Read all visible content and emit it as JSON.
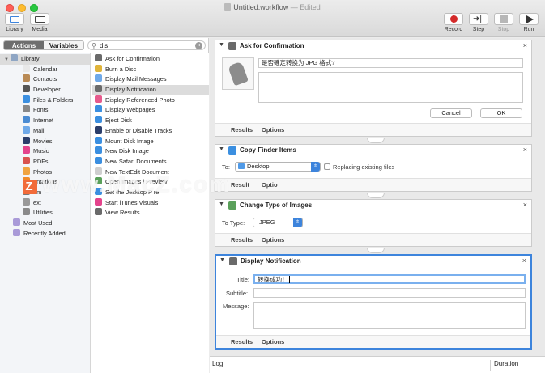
{
  "window": {
    "title": "Untitled.workflow",
    "subtitle": "— Edited"
  },
  "toolbar": {
    "library_label": "Library",
    "media_label": "Media",
    "record_label": "Record",
    "step_label": "Step",
    "stop_label": "Stop",
    "run_label": "Run"
  },
  "sidebar": {
    "tabs": {
      "actions": "Actions",
      "variables": "Variables"
    },
    "search": {
      "value": "dis"
    },
    "library": {
      "root": "Library",
      "items": [
        {
          "label": "Calendar",
          "icon": "calendar-icon",
          "color": "#e8e8e8"
        },
        {
          "label": "Contacts",
          "icon": "contacts-icon",
          "color": "#b98a55"
        },
        {
          "label": "Developer",
          "icon": "developer-icon",
          "color": "#555555"
        },
        {
          "label": "Files & Folders",
          "icon": "finder-icon",
          "color": "#3b8fe0"
        },
        {
          "label": "Fonts",
          "icon": "fonts-icon",
          "color": "#888888"
        },
        {
          "label": "Internet",
          "icon": "globe-icon",
          "color": "#4a8bd2"
        },
        {
          "label": "Mail",
          "icon": "mail-icon",
          "color": "#6fa9e8"
        },
        {
          "label": "Movies",
          "icon": "movies-icon",
          "color": "#2b3e6b"
        },
        {
          "label": "Music",
          "icon": "music-icon",
          "color": "#e4438c"
        },
        {
          "label": "PDFs",
          "icon": "pdf-icon",
          "color": "#d9534f"
        },
        {
          "label": "Photos",
          "icon": "photos-icon",
          "color": "#f0a440"
        },
        {
          "label": "entations",
          "icon": "presentation-icon",
          "color": "#f08a2a"
        },
        {
          "label": "em",
          "icon": "system-icon",
          "color": "#777777"
        },
        {
          "label": "ext",
          "icon": "text-icon",
          "color": "#999999"
        },
        {
          "label": "Utilities",
          "icon": "utilities-icon",
          "color": "#8a8a8a"
        }
      ],
      "most_used": "Most Used",
      "recently_added": "Recently Added"
    },
    "actions": [
      {
        "label": "Ask for Confirmation",
        "icon": "automator-icon",
        "color": "#6a6a6a"
      },
      {
        "label": "Burn a Disc",
        "icon": "burn-icon",
        "color": "#e0b43a"
      },
      {
        "label": "Display Mail Messages",
        "icon": "mail-icon",
        "color": "#6fa9e8"
      },
      {
        "label": "Display Notification",
        "icon": "automator-icon",
        "color": "#6a6a6a"
      },
      {
        "label": "Display Referenced Photo",
        "icon": "photos-icon",
        "color": "#e65a8c"
      },
      {
        "label": "Display Webpages",
        "icon": "safari-icon",
        "color": "#3b8fe0"
      },
      {
        "label": "Eject Disk",
        "icon": "finder-icon",
        "color": "#3b8fe0"
      },
      {
        "label": "Enable or Disable Tracks",
        "icon": "quicktime-icon",
        "color": "#2b3e6b"
      },
      {
        "label": "Mount Disk Image",
        "icon": "finder-icon",
        "color": "#3b8fe0"
      },
      {
        "label": "New Disk Image",
        "icon": "finder-icon",
        "color": "#3b8fe0"
      },
      {
        "label": "New Safari Documents",
        "icon": "safari-icon",
        "color": "#3b8fe0"
      },
      {
        "label": "New TextEdit Document",
        "icon": "textedit-icon",
        "color": "#cfcfcf"
      },
      {
        "label": "Open Images i  Preview",
        "icon": "preview-icon",
        "color": "#5aa05a"
      },
      {
        "label": "Set the Jesktop P  re",
        "icon": "desktop-icon",
        "color": "#3b8fe0"
      },
      {
        "label": "Start iTunes Visuals",
        "icon": "itunes-icon",
        "color": "#e4438c"
      },
      {
        "label": "View Results",
        "icon": "automator-icon",
        "color": "#6a6a6a"
      }
    ]
  },
  "workflow": {
    "ask": {
      "title": "Ask for Confirmation",
      "message": "是否確定转换为 JPG 格式?",
      "cancel": "Cancel",
      "ok": "OK",
      "results": "Results",
      "options": "Options"
    },
    "copy": {
      "title": "Copy Finder Items",
      "to_label": "To:",
      "destination": "Desktop",
      "replace_label": "Replacing existing files",
      "results": "Result",
      "options": "Optio"
    },
    "change": {
      "title": "Change Type of Images",
      "type_label": "To Type:",
      "type_value": "JPEG",
      "results": "Results",
      "options": "Options"
    },
    "notify": {
      "title": "Display Notification",
      "title_label": "Title:",
      "title_value": "转换成功！",
      "subtitle_label": "Subtitle:",
      "message_label": "Message:",
      "results": "Results",
      "options": "Options"
    }
  },
  "log": {
    "log_label": "Log",
    "duration_label": "Duration"
  },
  "watermark": {
    "text": "www.MacZ.com",
    "badge": "Z"
  }
}
